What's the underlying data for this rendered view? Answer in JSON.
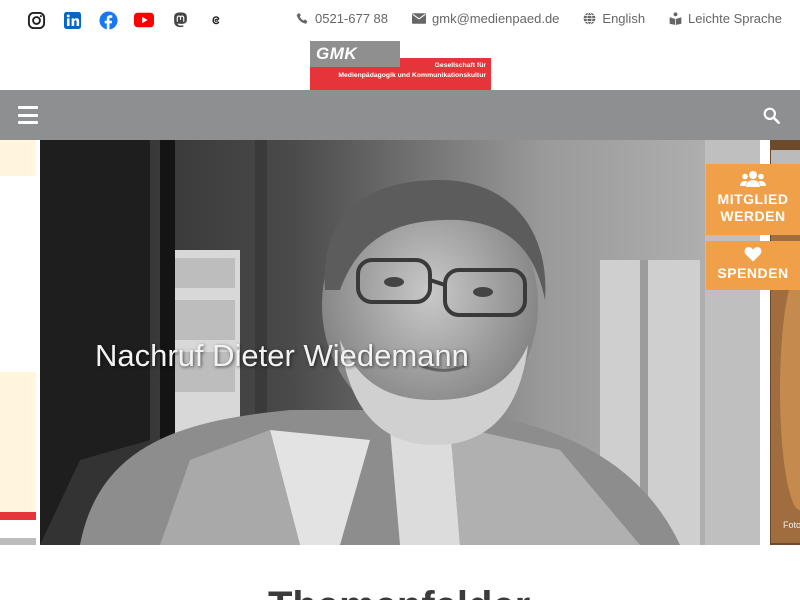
{
  "social": {
    "icons": [
      "instagram-icon",
      "linkedin-icon",
      "facebook-icon",
      "youtube-icon",
      "mastodon-icon",
      "threads-icon"
    ]
  },
  "contact": {
    "phone": "0521-677 88",
    "email": "gmk@medienpaed.de",
    "language": "English",
    "easy_language": "Leichte Sprache"
  },
  "logo": {
    "abbr": "GMK",
    "line1": "Gesellschaft für",
    "line2": "Medienpädagogik und Kommunikationskultur"
  },
  "slider": {
    "title": "Nachruf Dieter Wiedemann",
    "next_credit": "Foto"
  },
  "cta": {
    "member_label_1": "MITGLIED",
    "member_label_2": "WERDEN",
    "donate_label": "SPENDEN"
  },
  "colors": {
    "accent_red": "#e5353a",
    "nav_grey": "#8e8f91",
    "cta_orange": "#f1a04a"
  },
  "bottom": {
    "heading_partial": "Themenfelder"
  }
}
